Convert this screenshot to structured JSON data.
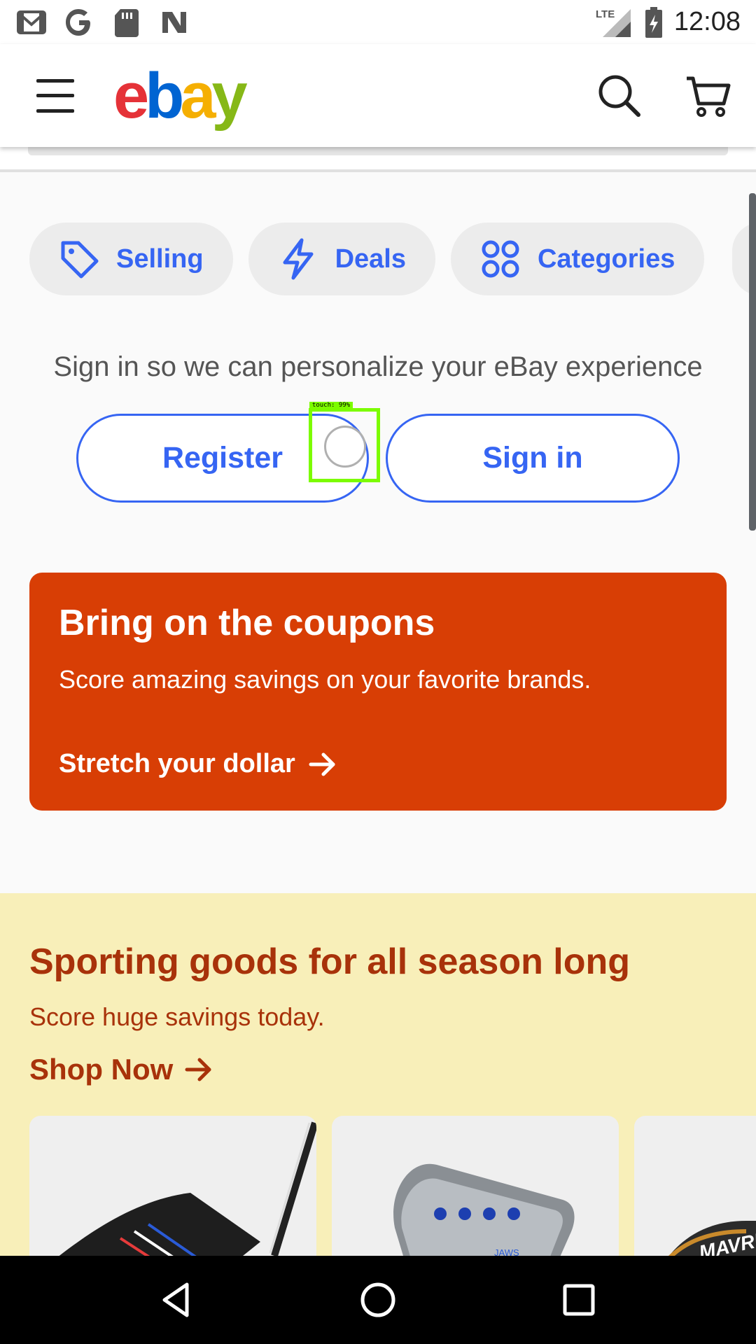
{
  "status_bar": {
    "time": "12:08",
    "network": "LTE",
    "left_icons": [
      "gmail-icon",
      "google-icon",
      "sd-card-icon",
      "news-icon"
    ]
  },
  "header": {
    "logo": {
      "e": "e",
      "b": "b",
      "a": "a",
      "y": "y"
    },
    "icons": [
      "menu-icon",
      "search-icon",
      "cart-icon"
    ]
  },
  "chips": [
    {
      "label": "Selling",
      "icon": "tag-icon"
    },
    {
      "label": "Deals",
      "icon": "lightning-icon"
    },
    {
      "label": "Categories",
      "icon": "grid-icon"
    }
  ],
  "signin": {
    "prompt": "Sign in so we can personalize your eBay experience",
    "register_label": "Register",
    "signin_label": "Sign in"
  },
  "touch_overlay": {
    "label": "touch: 99%"
  },
  "coupon_banner": {
    "title": "Bring on the coupons",
    "subtitle": "Score amazing savings on your favorite brands.",
    "cta": "Stretch your dollar",
    "background": "#d83e05"
  },
  "sporting": {
    "title": "Sporting goods for all season long",
    "subtitle": "Score huge savings today.",
    "cta": "Shop Now",
    "background": "#f8efb9",
    "text_color": "#a8320a",
    "card_2_brand": "JAWS",
    "card_3_brand": "MAVRIK"
  },
  "colors": {
    "accent": "#3665f3"
  },
  "nav_bar": {
    "icons": [
      "back-icon",
      "home-icon",
      "recents-icon"
    ]
  }
}
